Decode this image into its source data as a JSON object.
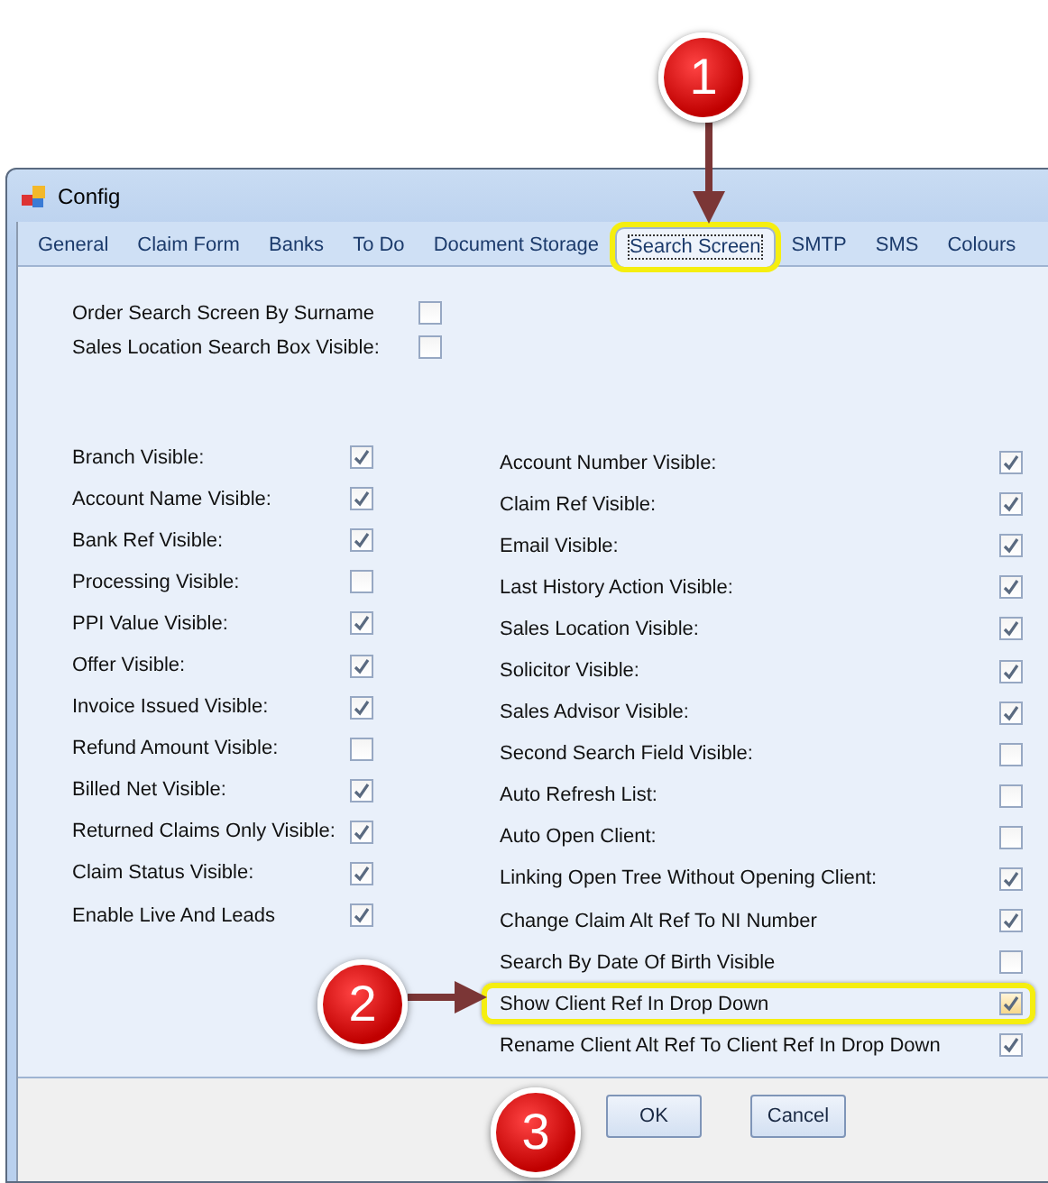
{
  "window": {
    "title": "Config"
  },
  "tabs": [
    {
      "label": "General",
      "selected": false,
      "highlighted": false
    },
    {
      "label": "Claim Form",
      "selected": false,
      "highlighted": false
    },
    {
      "label": "Banks",
      "selected": false,
      "highlighted": false
    },
    {
      "label": "To Do",
      "selected": false,
      "highlighted": false
    },
    {
      "label": "Document Storage",
      "selected": false,
      "highlighted": false
    },
    {
      "label": "Search Screen",
      "selected": true,
      "highlighted": true
    },
    {
      "label": "SMTP",
      "selected": false,
      "highlighted": false
    },
    {
      "label": "SMS",
      "selected": false,
      "highlighted": false
    },
    {
      "label": "Colours",
      "selected": false,
      "highlighted": false
    }
  ],
  "top_options": [
    {
      "label": "Order Search Screen By Surname",
      "checked": false
    },
    {
      "label": "Sales Location Search Box Visible:",
      "checked": false
    }
  ],
  "left_options": [
    {
      "label": "Branch Visible:",
      "checked": true
    },
    {
      "label": "Account Name Visible:",
      "checked": true
    },
    {
      "label": "Bank Ref Visible:",
      "checked": true
    },
    {
      "label": "Processing Visible:",
      "checked": false
    },
    {
      "label": "PPI Value Visible:",
      "checked": true
    },
    {
      "label": "Offer Visible:",
      "checked": true
    },
    {
      "label": "Invoice Issued Visible:",
      "checked": true
    },
    {
      "label": "Refund Amount Visible:",
      "checked": false
    },
    {
      "label": "Billed Net Visible:",
      "checked": true
    },
    {
      "label": "Returned Claims Only Visible:",
      "checked": true
    },
    {
      "label": "Claim Status Visible:",
      "checked": true
    },
    {
      "label": "Enable Live And Leads",
      "checked": true
    }
  ],
  "right_options": [
    {
      "label": "Account Number Visible:",
      "checked": true,
      "highlighted": false
    },
    {
      "label": "Claim Ref Visible:",
      "checked": true,
      "highlighted": false
    },
    {
      "label": "Email Visible:",
      "checked": true,
      "highlighted": false
    },
    {
      "label": "Last History Action Visible:",
      "checked": true,
      "highlighted": false
    },
    {
      "label": "Sales Location Visible:",
      "checked": true,
      "highlighted": false
    },
    {
      "label": "Solicitor Visible:",
      "checked": true,
      "highlighted": false
    },
    {
      "label": "Sales Advisor Visible:",
      "checked": true,
      "highlighted": false
    },
    {
      "label": "Second Search Field Visible:",
      "checked": false,
      "highlighted": false
    },
    {
      "label": "Auto Refresh List:",
      "checked": false,
      "highlighted": false
    },
    {
      "label": "Auto Open Client:",
      "checked": false,
      "highlighted": false
    },
    {
      "label": "Linking Open Tree Without Opening Client:",
      "checked": true,
      "highlighted": false
    },
    {
      "label": "Change Claim Alt Ref To NI Number",
      "checked": true,
      "highlighted": false
    },
    {
      "label": "Search By Date Of Birth Visible",
      "checked": false,
      "highlighted": false
    },
    {
      "label": "Show Client Ref In Drop Down",
      "checked": true,
      "highlighted": true
    },
    {
      "label": "Rename Client Alt Ref To Client Ref In Drop Down",
      "checked": true,
      "highlighted": false
    }
  ],
  "buttons": [
    "OK",
    "Cancel"
  ],
  "callouts": [
    {
      "number": "1"
    },
    {
      "number": "2"
    },
    {
      "number": "3"
    }
  ]
}
